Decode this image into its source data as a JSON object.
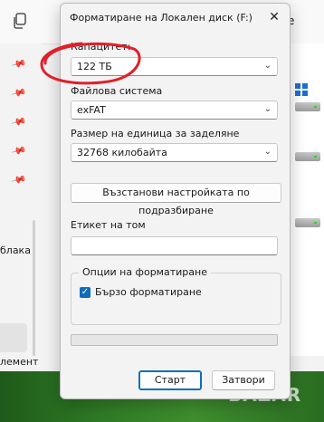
{
  "background": {
    "top_right_text": "е",
    "sidebar_label": "блака",
    "status_label": "лемент",
    "watermark": "BAZAR"
  },
  "dialog": {
    "title": "Форматиране на Локален диск (F:)",
    "close_glyph": "✕",
    "capacity": {
      "label": "Капацитет:",
      "value": "122 TБ"
    },
    "filesystem": {
      "label": "Файлова система",
      "value": "exFAT"
    },
    "allocation": {
      "label": "Размер на единица за заделяне",
      "value": "32768 килобайта"
    },
    "restore_defaults_label": "Възстанови настройката по подразбиране",
    "volume_label": {
      "label": "Етикет на том",
      "value": ""
    },
    "options": {
      "legend": "Опции на форматиране",
      "quick_format_label": "Бързо форматиране",
      "quick_format_checked": true
    },
    "progress": 0,
    "start_label": "Старт",
    "close_label": "Затвори"
  },
  "colors": {
    "accent": "#0f6cbd",
    "annotation": "#e0202a"
  }
}
